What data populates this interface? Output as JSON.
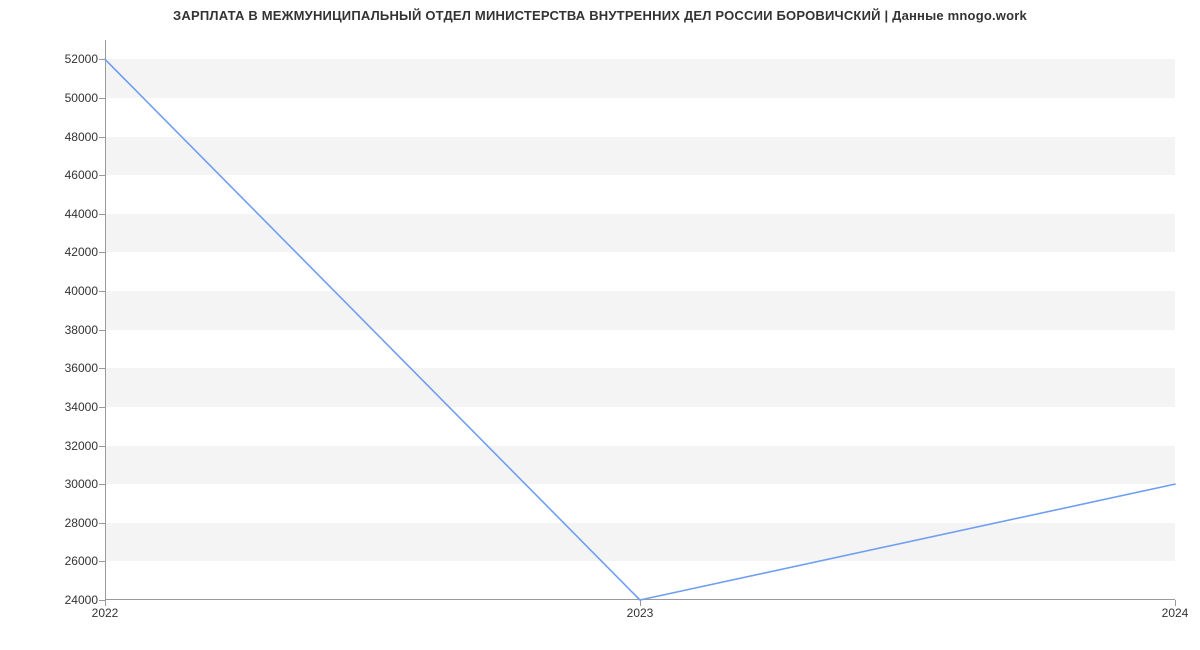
{
  "chart_data": {
    "type": "line",
    "title": "ЗАРПЛАТА В МЕЖМУНИЦИПАЛЬНЫЙ ОТДЕЛ МИНИСТЕРСТВА ВНУТРЕННИХ ДЕЛ РОССИИ БОРОВИЧСКИЙ | Данные mnogo.work",
    "x": [
      2022,
      2023,
      2024
    ],
    "values": [
      52000,
      24000,
      30000
    ],
    "x_tick_labels": [
      "2022",
      "2023",
      "2024"
    ],
    "y_ticks": [
      24000,
      26000,
      28000,
      30000,
      32000,
      34000,
      36000,
      38000,
      40000,
      42000,
      44000,
      46000,
      48000,
      50000,
      52000
    ],
    "y_tick_labels": [
      "24000",
      "26000",
      "28000",
      "30000",
      "32000",
      "34000",
      "36000",
      "38000",
      "40000",
      "42000",
      "44000",
      "46000",
      "48000",
      "50000",
      "52000"
    ],
    "xlabel": "",
    "ylabel": "",
    "xlim": [
      2022,
      2024
    ],
    "ylim": [
      24000,
      53000
    ],
    "colors": {
      "line": "#6f9ef2",
      "band": "#f4f4f4",
      "axis": "#9a9a9a"
    }
  }
}
